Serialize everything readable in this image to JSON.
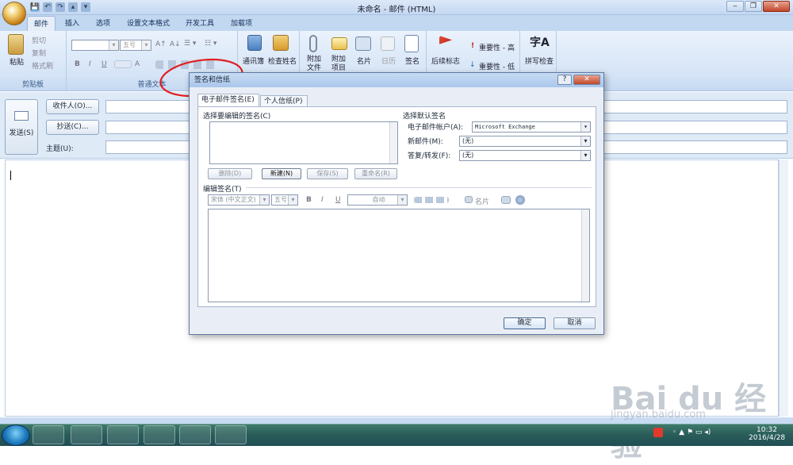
{
  "window": {
    "title": "未命名 - 邮件 (HTML)"
  },
  "quick_access": [
    "💾",
    "↶",
    "↷",
    "▴",
    "▾"
  ],
  "ribbon_tabs": [
    "邮件",
    "插入",
    "选项",
    "设置文本格式",
    "开发工具",
    "加载项"
  ],
  "clipboard": {
    "paste": "粘贴",
    "cut": "剪切",
    "copy": "复制",
    "format_painter": "格式刷",
    "group": "剪贴板"
  },
  "basic_text": {
    "font_size": "五号",
    "bold": "B",
    "italic": "I",
    "underline": "U",
    "grow": "A↑",
    "shrink": "A↓",
    "clear": "A",
    "group": "普通文本"
  },
  "names": {
    "address_book": "通讯簿",
    "check_names": "检查姓名"
  },
  "include": {
    "attach_file": "附加\n文件",
    "attach_item": "附加\n项目",
    "business_card": "名片",
    "calendar": "日历",
    "signature": "签名"
  },
  "options": {
    "follow_up": "后续标志",
    "high": "重要性 - 高",
    "low": "重要性 - 低"
  },
  "proofing": {
    "spelling": "拼写检查"
  },
  "header": {
    "send": "发送(S)",
    "to": "收件人(O)...",
    "cc": "抄送(C)...",
    "subject": "主题(U):"
  },
  "dialog": {
    "title": "签名和信纸",
    "help": "?",
    "close": "✕",
    "tabs": [
      "电子邮件签名(E)",
      "个人信纸(P)"
    ],
    "select_label": "选择要编辑的签名(C)",
    "buttons": {
      "delete": "删除(D)",
      "new": "新建(N)",
      "save": "保存(S)",
      "rename": "重命名(R)"
    },
    "default": {
      "heading": "选择默认签名",
      "account_label": "电子邮件帐户(A):",
      "account_value": "Microsoft Exchange",
      "new_label": "新邮件(M):",
      "new_value": "(无)",
      "reply_label": "答复/转发(F):",
      "reply_value": "(无)"
    },
    "edit_label": "编辑签名(T)",
    "font": "宋体 (中文正文)",
    "size": "五号",
    "color": "自动",
    "fmt": {
      "bold": "B",
      "italic": "I",
      "underline": "U"
    },
    "card": "名片",
    "ok": "确定",
    "cancel": "取消"
  },
  "tray": {
    "time": "10:32",
    "date": "2016/4/28"
  },
  "watermark": {
    "brand": "Bai du 经验",
    "url": "jingyan.baidu.com"
  },
  "colors": {
    "accent": "#1e5aa8",
    "annotation": "#e02020"
  }
}
